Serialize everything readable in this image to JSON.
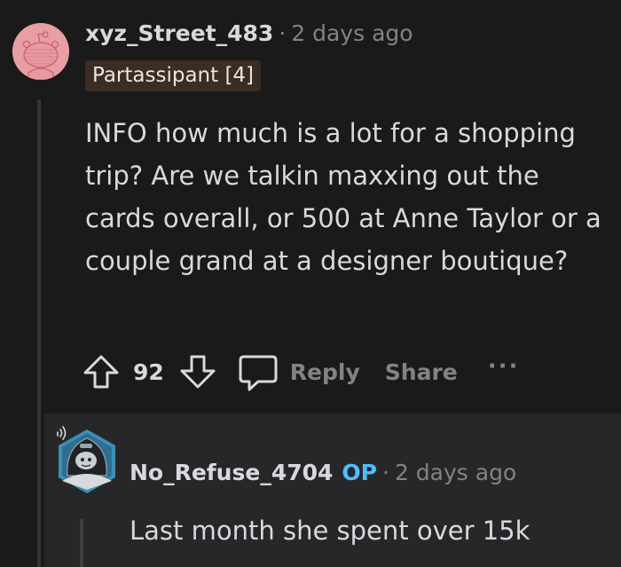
{
  "comment": {
    "username": "xyz_Street_483",
    "separator": "·",
    "time": "2 days ago",
    "flair": "Partassipant [4]",
    "body": "INFO how much is a lot for a shopping trip? Are we talkin maxxing out the cards overall, or 500 at Anne Taylor or a couple grand at a designer boutique?",
    "score": "92",
    "reply_label": "Reply",
    "share_label": "Share",
    "more_label": "···"
  },
  "reply": {
    "username": "No_Refuse_4704",
    "op_badge": "OP",
    "separator": "·",
    "time": "2 days ago",
    "body": "Last month she spent over 15k"
  },
  "icons": {
    "upvote": "arrow-up-icon",
    "downvote": "arrow-down-icon",
    "reply": "speech-bubble-icon",
    "more": "ellipsis-icon"
  },
  "colors": {
    "background": "#1a1a1b",
    "reply_background": "#272729",
    "text": "#d7dadc",
    "muted": "#818384",
    "op_badge": "#4fbcff",
    "flair_background": "#3b2c24",
    "avatar1_background": "#e79fa3"
  }
}
